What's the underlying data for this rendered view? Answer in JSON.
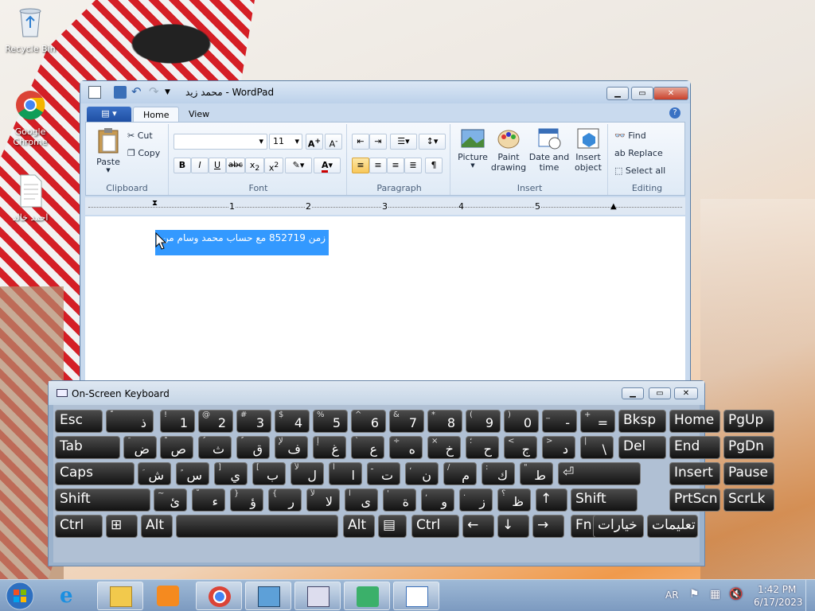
{
  "desktop": {
    "icons": [
      {
        "label": "Recycle Bin"
      },
      {
        "label": "Google Chrome"
      },
      {
        "label": "احمد خالد"
      }
    ]
  },
  "wordpad": {
    "title": "محمد زيد - WordPad",
    "tabs": [
      "Home",
      "View"
    ],
    "clipboard": {
      "paste": "Paste",
      "cut": "Cut",
      "copy": "Copy",
      "label": "Clipboard"
    },
    "font": {
      "size": "11",
      "label": "Font"
    },
    "paragraph": {
      "label": "Paragraph"
    },
    "insert": {
      "picture": "Picture",
      "paint": "Paint drawing",
      "datetime": "Date and time",
      "object": "Insert object",
      "label": "Insert"
    },
    "editing": {
      "find": "Find",
      "replace": "Replace",
      "selectall": "Select all",
      "label": "Editing"
    },
    "ruler": [
      "1",
      "2",
      "3",
      "4",
      "5"
    ],
    "doc_text": "زمن 852719 مع حساب محمد وسام من"
  },
  "osk": {
    "title": "On-Screen Keyboard"
  },
  "taskbar": {
    "lang": "AR",
    "time": "1:42 PM",
    "date": "6/17/2023"
  }
}
